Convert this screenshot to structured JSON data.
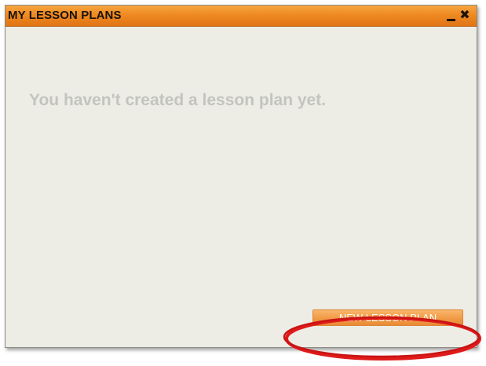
{
  "window": {
    "title": "MY LESSON PLANS",
    "controls": {
      "minimize_icon": "minimize-icon",
      "close_icon": "close-icon",
      "close_glyph": "✖"
    }
  },
  "content": {
    "empty_message": "You haven't created a lesson plan yet."
  },
  "actions": {
    "new_plan_label": "NEW LESSON PLAN"
  },
  "colors": {
    "titlebar": "#ef8a22",
    "panel_background": "#edede6",
    "button": "#f19a46",
    "highlight": "#e01a1a"
  }
}
